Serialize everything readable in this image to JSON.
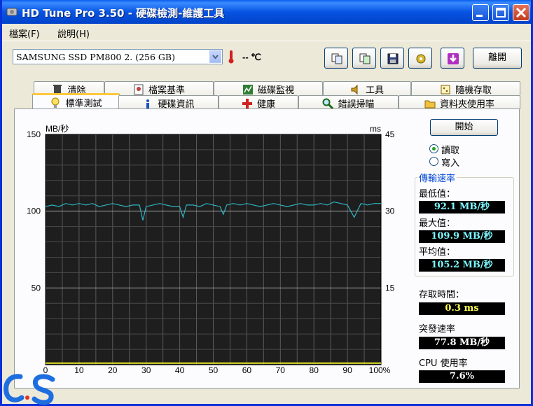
{
  "window": {
    "title": "HD Tune Pro 3.50 - 硬碟檢測-維護工具"
  },
  "menu": [
    {
      "label": "檔案(F)"
    },
    {
      "label": "說明(H)"
    }
  ],
  "toolbar": {
    "drive": "SAMSUNG SSD PM800 2. (256 GB)",
    "temperature": "-- ℃",
    "exit_label": "離開"
  },
  "tabs_top": [
    {
      "label": "清除",
      "icon": "trash-icon"
    },
    {
      "label": "檔案基準",
      "icon": "file-benchmark-icon"
    },
    {
      "label": "磁碟監視",
      "icon": "disk-monitor-icon"
    },
    {
      "label": "工具",
      "icon": "speaker-icon"
    },
    {
      "label": "隨機存取",
      "icon": "random-access-icon"
    }
  ],
  "tabs_bottom": [
    {
      "label": "標準測試",
      "icon": "bulb-icon",
      "active": true
    },
    {
      "label": "硬碟資訊",
      "icon": "info-icon"
    },
    {
      "label": "健康",
      "icon": "red-cross-icon"
    },
    {
      "label": "錯誤掃瞄",
      "icon": "magnifier-icon"
    },
    {
      "label": "資料夾使用率",
      "icon": "folder-icon"
    }
  ],
  "controls": {
    "start_label": "開始",
    "read_label": "讀取",
    "write_label": "寫入",
    "selected": "read"
  },
  "stats": {
    "group_title": "傳輸速率",
    "min_label": "最低值：",
    "min_value": "92.1 MB/秒",
    "max_label": "最大值：",
    "max_value": "109.9 MB/秒",
    "avg_label": "平均值：",
    "avg_value": "105.2 MB/秒",
    "access_label": "存取時間：",
    "access_value": "0.3 ms",
    "burst_label": "突發速率",
    "burst_value": "77.8 MB/秒",
    "cpu_label": "CPU 使用率",
    "cpu_value": "7.6%"
  },
  "chart_data": {
    "type": "line",
    "ylabel_left": "MB/秒",
    "ylabel_right": "ms",
    "xlim": [
      0,
      100
    ],
    "ylim_left": [
      0,
      150
    ],
    "ylim_right": [
      0,
      45
    ],
    "x_ticks": [
      "0",
      "10",
      "20",
      "30",
      "40",
      "50",
      "60",
      "70",
      "80",
      "90",
      "100%"
    ],
    "y_ticks_left": [
      "150",
      "100",
      "50"
    ],
    "y_ticks_right": [
      "45",
      "30",
      "15"
    ],
    "grid": true,
    "background_color": "#1E1E1E",
    "series": [
      {
        "color": "#2FB4C0",
        "x": [
          0,
          2,
          4,
          6,
          8,
          10,
          12,
          14,
          16,
          18,
          20,
          22,
          24,
          26,
          28,
          29,
          30,
          32,
          34,
          36,
          38,
          40,
          41,
          42,
          44,
          46,
          48,
          50,
          52,
          53,
          54,
          56,
          58,
          60,
          62,
          64,
          66,
          68,
          70,
          72,
          74,
          76,
          78,
          80,
          82,
          84,
          86,
          88,
          90,
          92,
          94,
          96,
          98,
          100
        ],
        "values": [
          103,
          104,
          103,
          105,
          104,
          105,
          104,
          105,
          103,
          104,
          105,
          104,
          103,
          104,
          104,
          94,
          103,
          104,
          105,
          104,
          103,
          103,
          96,
          104,
          104,
          103,
          105,
          104,
          103,
          98,
          104,
          105,
          104,
          105,
          104,
          103,
          104,
          105,
          104,
          103,
          104,
          105,
          104,
          104,
          105,
          104,
          106,
          105,
          104,
          96,
          105,
          104,
          105,
          105
        ]
      },
      {
        "color": "#E8E820",
        "x": [
          0,
          10,
          20,
          30,
          40,
          50,
          60,
          70,
          80,
          90,
          100
        ],
        "values": [
          0.3,
          0.3,
          0.3,
          0.3,
          0.3,
          0.3,
          0.3,
          0.3,
          0.3,
          0.3,
          0.3
        ],
        "axis": "right"
      }
    ]
  }
}
